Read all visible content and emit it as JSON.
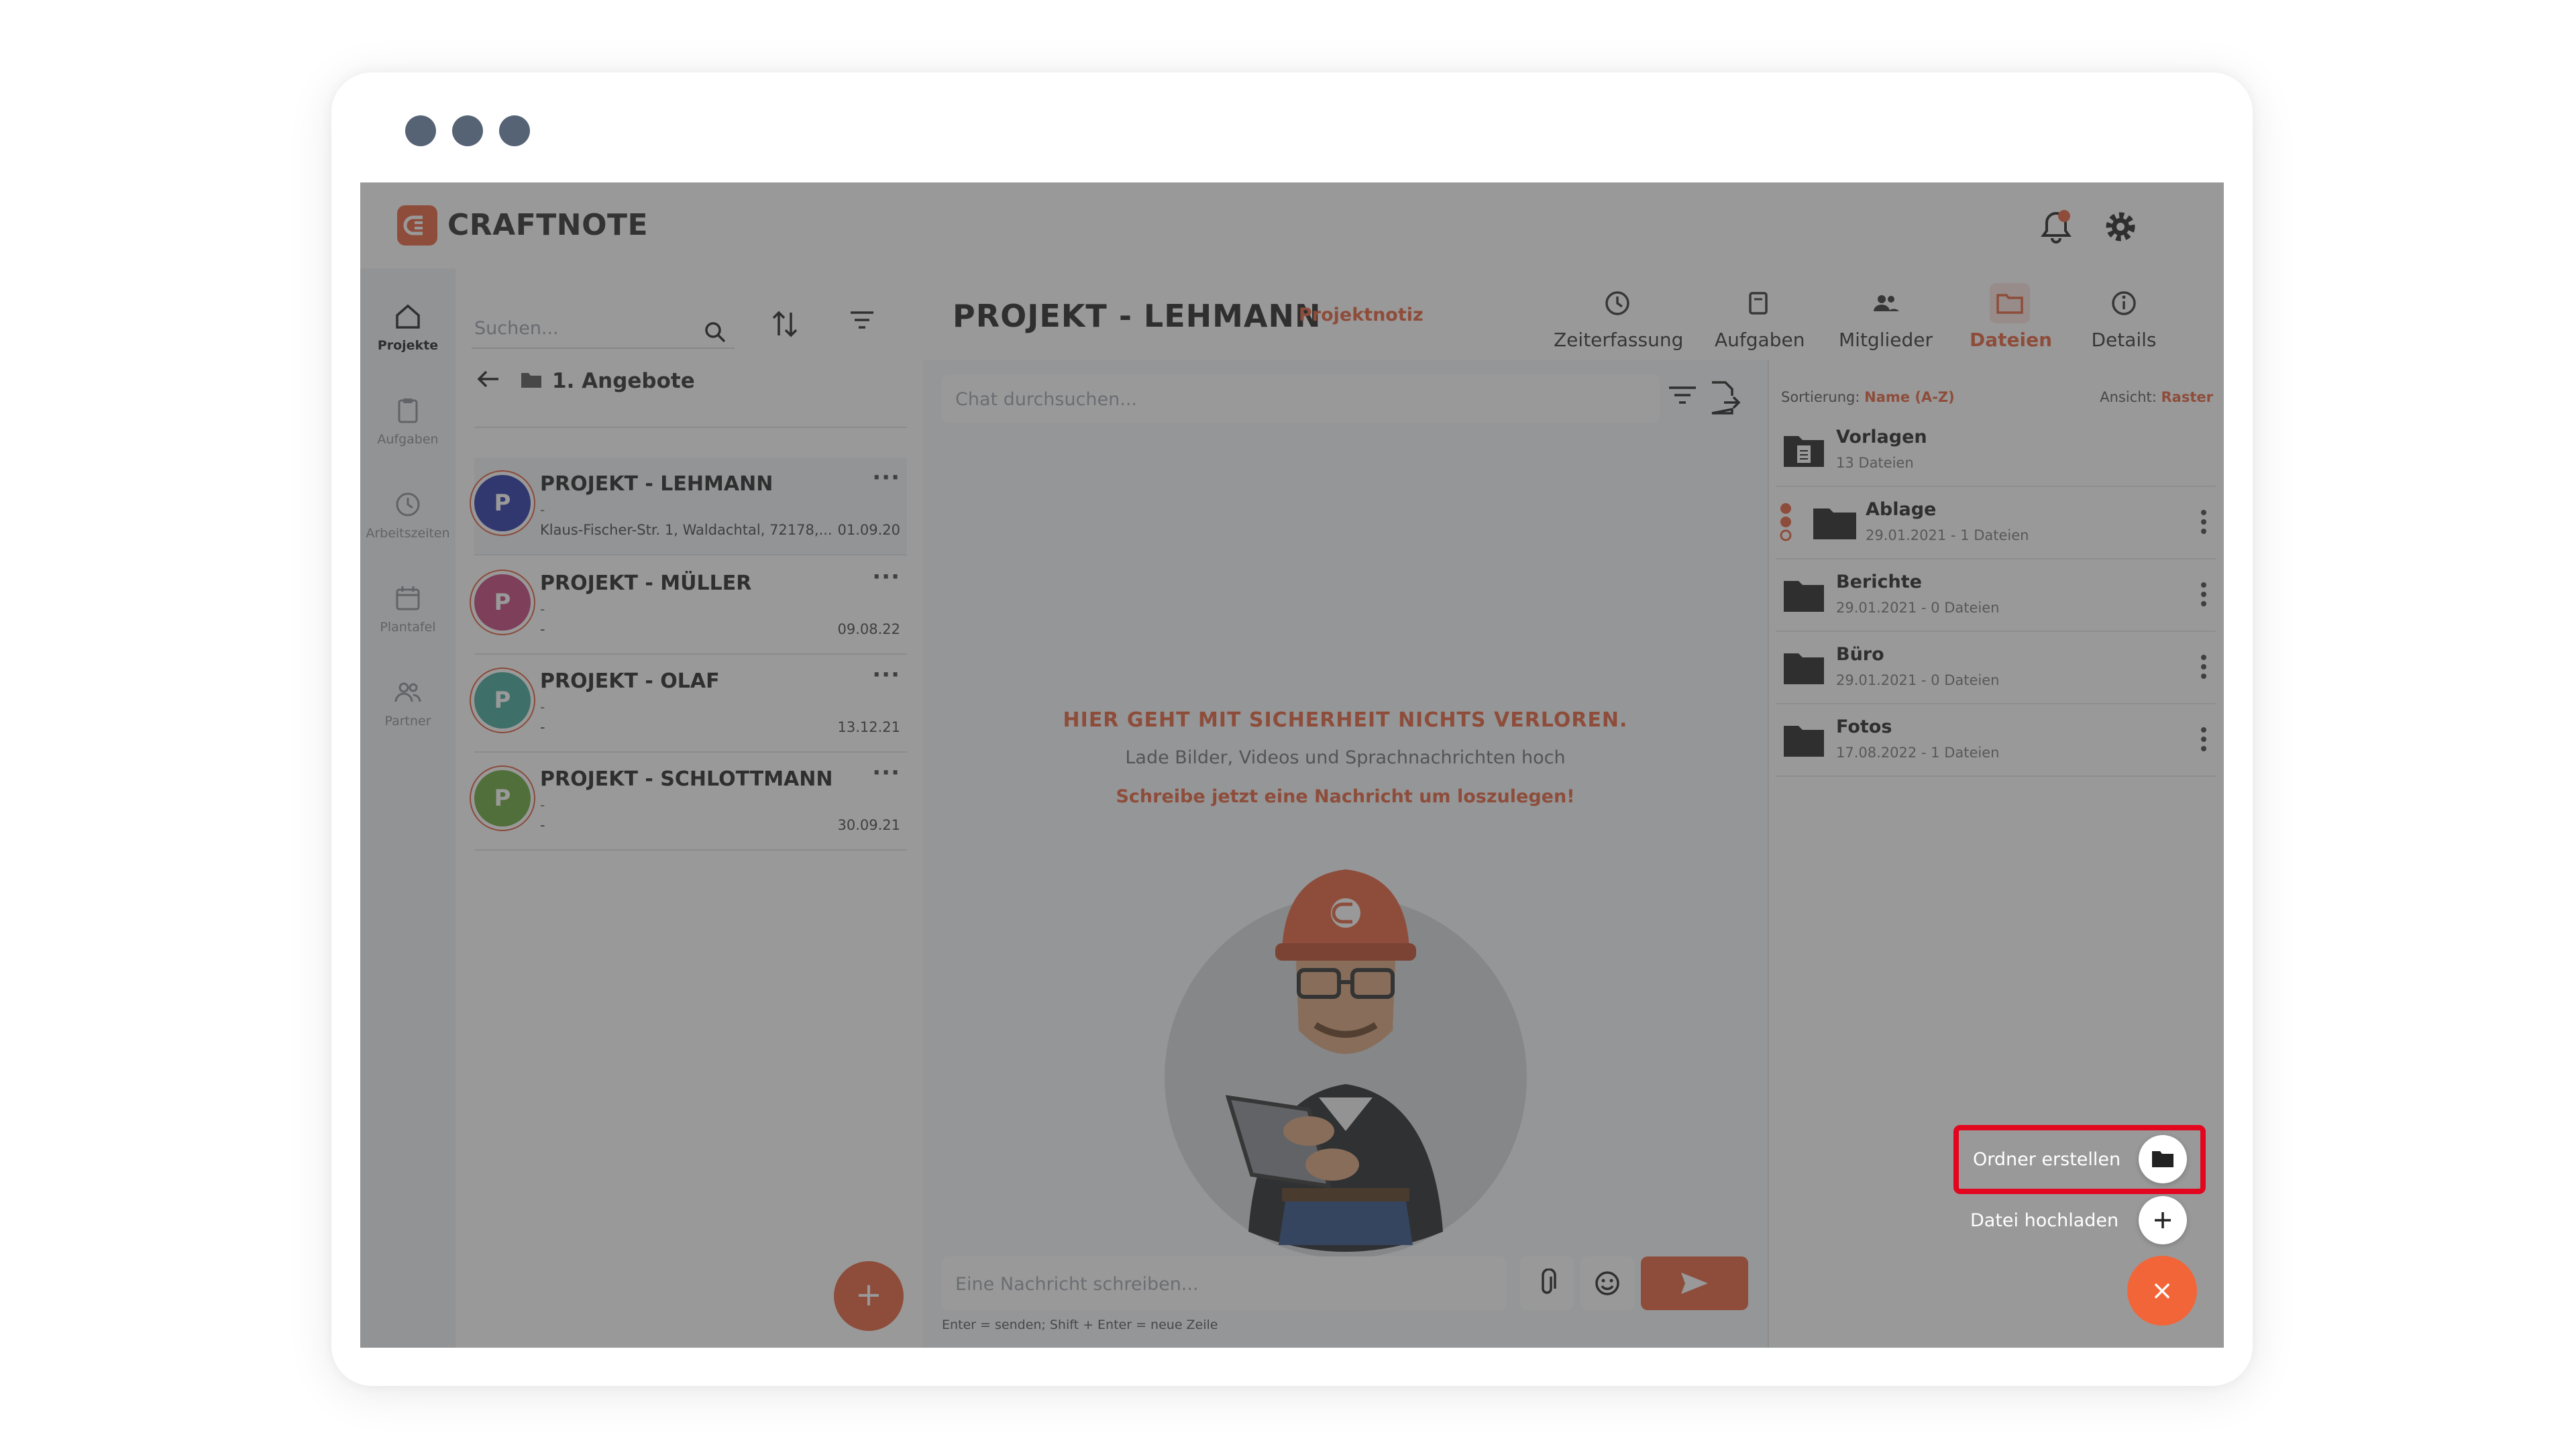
{
  "app": {
    "name": "CRAFTNOTE",
    "brand_color": "#e8603c"
  },
  "nav": [
    {
      "label": "Projekte",
      "icon": "home-icon",
      "active": true
    },
    {
      "label": "Aufgaben",
      "icon": "clipboard-icon"
    },
    {
      "label": "Arbeitszeiten",
      "icon": "clock-icon"
    },
    {
      "label": "Plantafel",
      "icon": "calendar-icon"
    },
    {
      "label": "Partner",
      "icon": "people-icon"
    }
  ],
  "list": {
    "search_placeholder": "Suchen...",
    "breadcrumb": "1. Angebote",
    "projects": [
      {
        "initial": "P",
        "color": "#2436a8",
        "title": "PROJEKT - LEHMANN",
        "sub": "-",
        "address": "Klaus-Fischer-Str. 1, Waldachtal, 72178,...",
        "date": "01.09.20"
      },
      {
        "initial": "P",
        "color": "#c4447a",
        "title": "PROJEKT - MÜLLER",
        "sub": "-",
        "address": "-",
        "date": "09.08.22"
      },
      {
        "initial": "P",
        "color": "#42a89a",
        "title": "PROJEKT - OLAF",
        "sub": "-",
        "address": "-",
        "date": "13.12.21"
      },
      {
        "initial": "P",
        "color": "#6aa83a",
        "title": "PROJEKT - SCHLOTTMANN",
        "sub": "-",
        "address": "-",
        "date": "30.09.21"
      }
    ],
    "more": "···",
    "add_label": "+"
  },
  "header": {
    "title": "PROJEKT - LEHMANN",
    "note": "Projektnotiz",
    "tabs": [
      {
        "label": "Zeiterfassung",
        "icon": "clock-icon"
      },
      {
        "label": "Aufgaben",
        "icon": "clipboard-icon"
      },
      {
        "label": "Mitglieder",
        "icon": "members-icon"
      },
      {
        "label": "Dateien",
        "icon": "folder-icon",
        "active": true
      },
      {
        "label": "Details",
        "icon": "info-icon"
      }
    ]
  },
  "chat": {
    "search_placeholder": "Chat durchsuchen...",
    "empty_title": "HIER GEHT MIT SICHERHEIT NICHTS VERLOREN.",
    "empty_text": "Lade Bilder, Videos und Sprachnachrichten hoch",
    "empty_cta": "Schreibe jetzt eine Nachricht um loszulegen!",
    "input_placeholder": "Eine Nachricht schreiben...",
    "hint": "Enter = senden; Shift + Enter = neue Zeile"
  },
  "files": {
    "sort_label": "Sortierung:",
    "sort_value": "Name (A-Z)",
    "view_label": "Ansicht:",
    "view_value": "Raster",
    "folders": [
      {
        "name": "Vorlagen",
        "meta": "13 Dateien",
        "icon": "template-folder-icon"
      },
      {
        "name": "Ablage",
        "meta": "29.01.2021 - 1 Dateien",
        "icon": "folder-icon"
      },
      {
        "name": "Berichte",
        "meta": "29.01.2021 - 0 Dateien",
        "icon": "folder-icon"
      },
      {
        "name": "Büro",
        "meta": "29.01.2021 - 0 Dateien",
        "icon": "folder-icon"
      },
      {
        "name": "Fotos",
        "meta": "17.08.2022 - 1 Dateien",
        "icon": "folder-icon"
      }
    ]
  },
  "fab_menu": {
    "create_folder": "Ordner erstellen",
    "upload_file": "Datei hochladen",
    "close": "×",
    "highlight_color": "#e3061f"
  }
}
